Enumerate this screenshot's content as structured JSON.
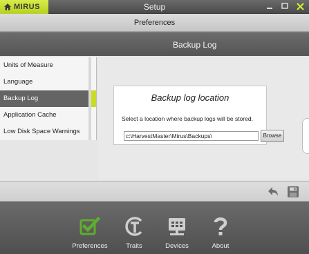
{
  "window": {
    "logo_text": "MIRUS",
    "title": "Setup"
  },
  "header": {
    "title": "Preferences"
  },
  "section": {
    "title": "Backup Log"
  },
  "sidebar": {
    "items": [
      {
        "label": "Units of Measure"
      },
      {
        "label": "Language"
      },
      {
        "label": "Backup Log"
      },
      {
        "label": "Application Cache"
      },
      {
        "label": "Low Disk Space Warnings"
      }
    ],
    "active_index": 2
  },
  "backup": {
    "title": "Backup log location",
    "description": "Select a location where backup logs will be stored.",
    "path": "c:\\HarvestMaster\\Mirus\\Backups\\",
    "browse_label": "Browse"
  },
  "nav": {
    "items": [
      {
        "label": "Preferences"
      },
      {
        "label": "Traits"
      },
      {
        "label": "Devices"
      },
      {
        "label": "About"
      }
    ]
  },
  "colors": {
    "accent": "#c7dd22",
    "check_green": "#5fae2b"
  }
}
